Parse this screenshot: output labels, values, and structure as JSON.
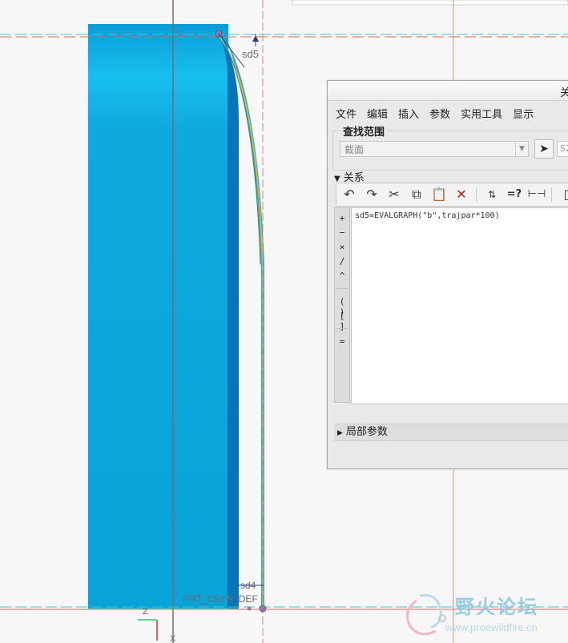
{
  "viewport": {
    "dimensions": {
      "sd5": "sd5",
      "sd4": "sd4"
    },
    "csys_label": "PRT_CSYS_DEF",
    "triad": {
      "z": "Z",
      "x": "X"
    }
  },
  "dialog": {
    "title": "关",
    "menu": [
      "文件",
      "编辑",
      "插入",
      "参数",
      "实用工具",
      "显示"
    ],
    "scope": {
      "legend": "查找范围",
      "select_value": "截面",
      "field_value": "S2"
    },
    "relations": {
      "header": "关系",
      "operators": [
        "+",
        "−",
        "×",
        "/",
        "^",
        "( )",
        "[ ]",
        "="
      ],
      "text": "sd5=EVALGRAPH(\"b\",trajpar*100)"
    },
    "local_params": "局部参数"
  },
  "watermark": {
    "brand": "野火论坛",
    "url": "www.proewildfire.cn"
  },
  "colors": {
    "part_blue": "#0aa8dc",
    "part_dark": "#0075b9",
    "ref_line_cyan": "#3ec7cc",
    "ref_line_red": "#d86a5a"
  }
}
